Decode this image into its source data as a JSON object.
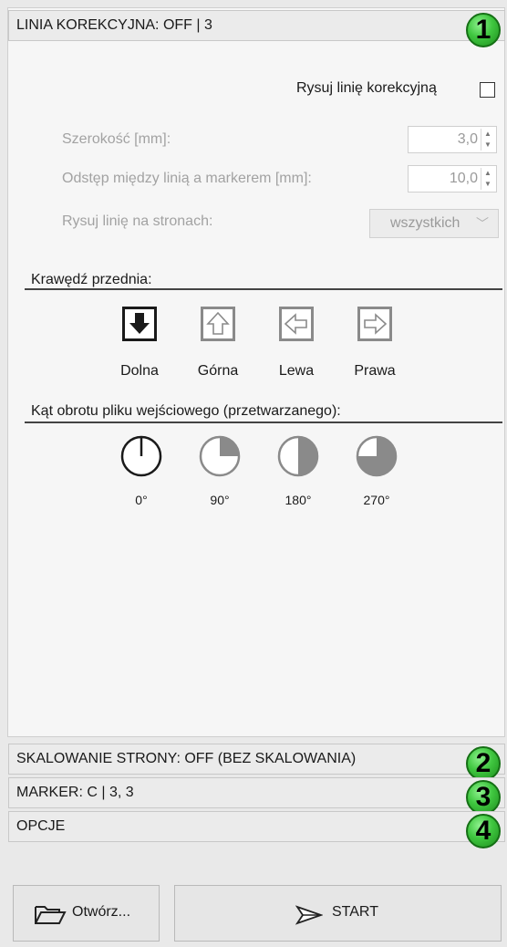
{
  "sections": [
    {
      "title": "LINIA KOREKCYJNA: OFF | 3",
      "badge": "1"
    },
    {
      "title": "SKALOWANIE STRONY: OFF (BEZ SKALOWANIA)",
      "badge": "2"
    },
    {
      "title": "MARKER: C | 3, 3",
      "badge": "3"
    },
    {
      "title": "OPCJE",
      "badge": "4"
    }
  ],
  "correction_line": {
    "draw_label": "Rysuj linię korekcyjną",
    "draw_checked": false,
    "width_label": "Szerokość [mm]:",
    "width_value": "3,0",
    "gap_label": "Odstęp między linią a markerem [mm]:",
    "gap_value": "10,0",
    "pages_label": "Rysuj linię na stronach:",
    "pages_value": "wszystkich"
  },
  "leading_edge": {
    "title": "Krawędź przednia:",
    "options": [
      "Dolna",
      "Górna",
      "Lewa",
      "Prawa"
    ],
    "selected": "Dolna"
  },
  "rotation": {
    "title": "Kąt obrotu pliku wejściowego (przetwarzanego):",
    "options": [
      "0°",
      "90°",
      "180°",
      "270°"
    ],
    "selected": "0°"
  },
  "buttons": {
    "open_label": "Otwórz...",
    "start_label": "START"
  },
  "colors": {
    "badge": "#3fc63f",
    "panel": "#f6f6f6",
    "header": "#ebebeb"
  }
}
